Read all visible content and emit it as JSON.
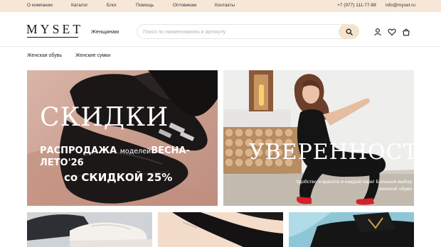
{
  "topbar": {
    "links": [
      "О компании",
      "Каталог",
      "Блог",
      "Помощь",
      "Оптовикам",
      "Контакты"
    ],
    "phone": "+7 (977) 111-77-88",
    "email": "info@myset.ru"
  },
  "header": {
    "logo": "MYSET",
    "nav_women": "Женщинам",
    "search_placeholder": "Поиск по наименованию и артикулу",
    "search_value": "",
    "icons": [
      "search-icon",
      "user-icon",
      "heart-icon",
      "bag-icon"
    ]
  },
  "categories": [
    "Женская обувь",
    "Женские сумки"
  ],
  "banners": [
    {
      "script_title": "СКИДКИ",
      "line1_bold": "РАСПРОДАЖА",
      "line1_light": "моделей",
      "line1_bold2": "ВЕСНА-",
      "line2": "ЛЕТО'26",
      "line3": "со СКИДКОЙ 25%"
    },
    {
      "script_title": "УВЕРЕННОСТЬ",
      "tagline_1": "Удобство и красота в каждой паре! Большой выбор",
      "tagline_2": "женской обуви"
    }
  ],
  "colors": {
    "topbar_bg": "#f7e7d6",
    "search_button_bg": "#f5e2cf",
    "accent_red": "#d61f2c"
  }
}
